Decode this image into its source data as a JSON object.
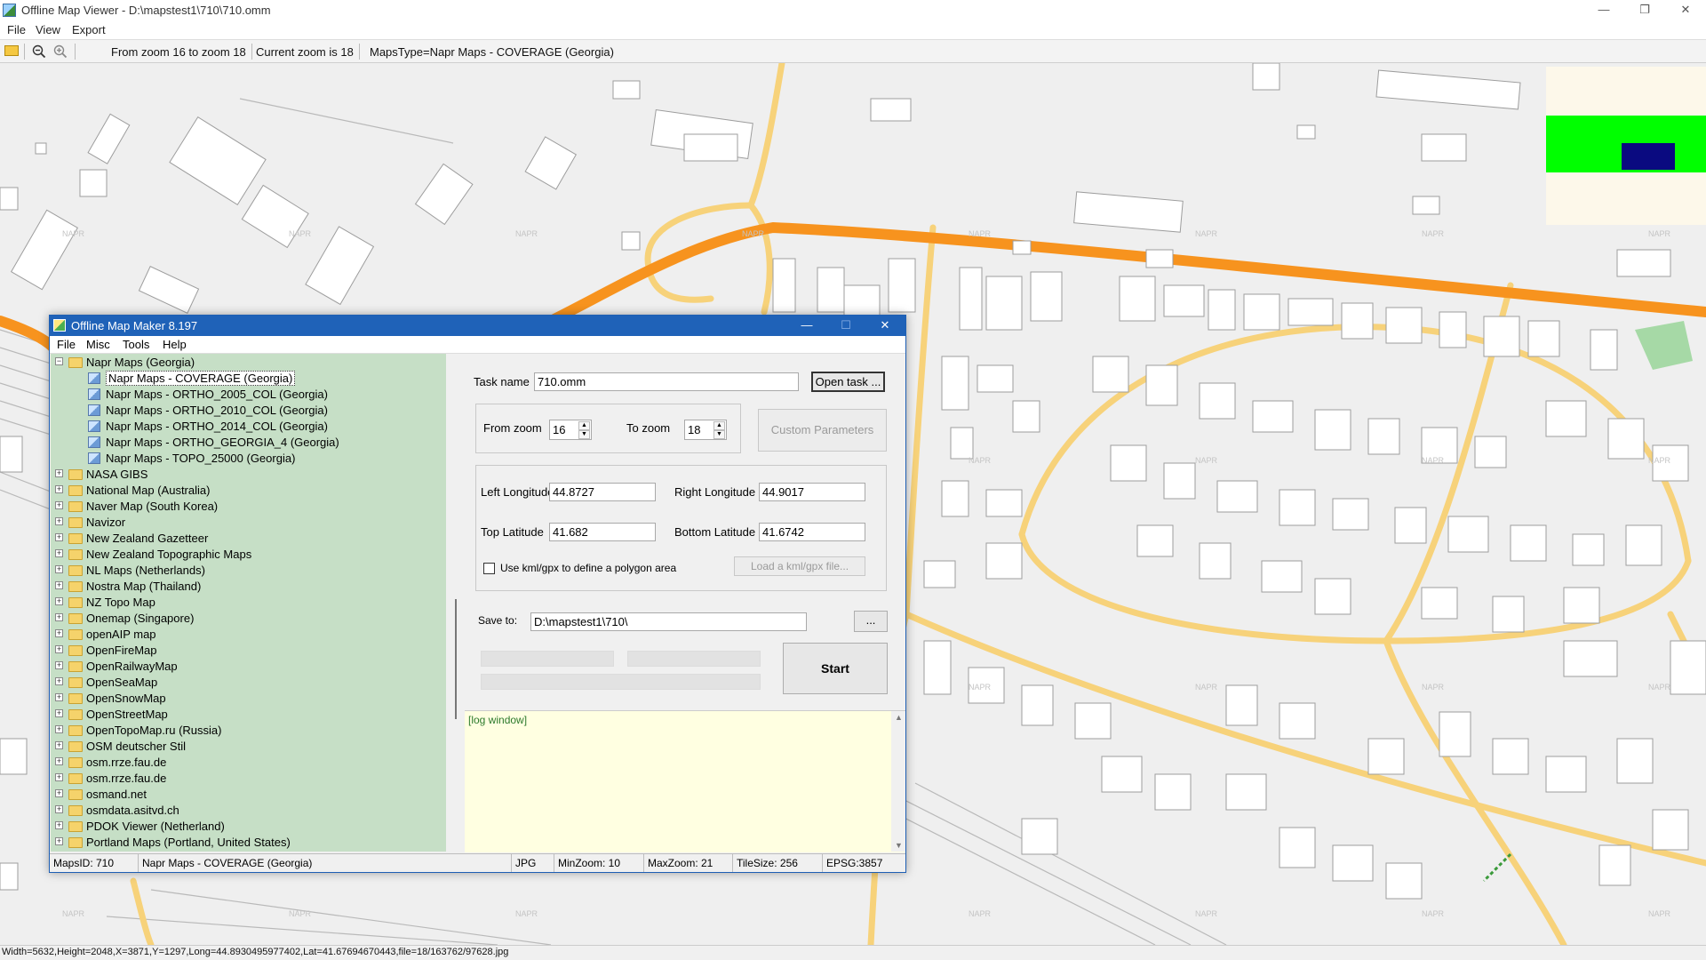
{
  "window": {
    "title": "Offline Map Viewer - D:\\mapstest1\\710\\710.omm",
    "minimize": "—",
    "maximize": "❐",
    "close": "✕"
  },
  "menu": [
    "File",
    "View",
    "Export"
  ],
  "toolbar": {
    "zoom_range": "From zoom 16 to zoom 18",
    "current_zoom": "Current zoom is 18",
    "maps_type": "MapsType=Napr Maps - COVERAGE (Georgia)"
  },
  "map": {
    "watermark": "NAPR",
    "colors": {
      "background": "#efefef",
      "major_road": "#f7931e",
      "minor_road": "#f7d27a",
      "building": "#ffffff",
      "green": "#a6d9a6"
    }
  },
  "minimap": {
    "colors": {
      "background": "#fdf8ea",
      "band": "#00ff00",
      "viewport": "#0a0a80"
    }
  },
  "statusbar": {
    "text": "Width=5632,Height=2048,X=3871,Y=1297,Long=44.8930495977402,Lat=41.67694670443,file=18/163762/97628.jpg"
  },
  "dialog": {
    "title": "Offline Map Maker 8.197",
    "minimize": "—",
    "maximize": "☐",
    "close": "✕",
    "menu": [
      "File",
      "Misc",
      "Tools",
      "Help"
    ],
    "tree": {
      "root": {
        "label": "Napr Maps (Georgia)",
        "expanded": true
      },
      "children": [
        {
          "label": "Napr Maps - COVERAGE (Georgia)",
          "selected": true
        },
        {
          "label": "Napr Maps - ORTHO_2005_COL (Georgia)"
        },
        {
          "label": "Napr Maps - ORTHO_2010_COL (Georgia)"
        },
        {
          "label": "Napr Maps - ORTHO_2014_COL (Georgia)"
        },
        {
          "label": "Napr Maps - ORTHO_GEORGIA_4 (Georgia)"
        },
        {
          "label": "Napr Maps - TOPO_25000 (Georgia)"
        }
      ],
      "folders": [
        "NASA GIBS",
        "National Map (Australia)",
        "Naver Map (South Korea)",
        "Navizor",
        "New Zealand Gazetteer",
        "New Zealand Topographic Maps",
        "NL Maps (Netherlands)",
        "Nostra Map (Thailand)",
        "NZ Topo Map",
        "Onemap (Singapore)",
        "openAIP map",
        "OpenFireMap",
        "OpenRailwayMap",
        "OpenSeaMap",
        "OpenSnowMap",
        "OpenStreetMap",
        "OpenTopoMap.ru (Russia)",
        "OSM deutscher Stil",
        "osm.rrze.fau.de",
        "osm.rrze.fau.de",
        "osmand.net",
        "osmdata.asitvd.ch",
        "PDOK Viewer (Netherland)",
        "Portland Maps (Portland, United States)"
      ]
    },
    "form": {
      "task_name_label": "Task name",
      "task_name_value": "710.omm",
      "open_task_button": "Open task ...",
      "from_zoom_label": "From zoom",
      "from_zoom_value": "16",
      "to_zoom_label": "To zoom",
      "to_zoom_value": "18",
      "custom_params_button": "Custom Parameters",
      "left_lon_label": "Left Longitude",
      "left_lon_value": "44.8727",
      "right_lon_label": "Right Longitude",
      "right_lon_value": "44.9017",
      "top_lat_label": "Top Latitude",
      "top_lat_value": "41.682",
      "bottom_lat_label": "Bottom Latitude",
      "bottom_lat_value": "41.6742",
      "kml_checkbox_label": "Use kml/gpx to define a polygon area",
      "kml_checked": false,
      "load_kml_button": "Load a kml/gpx file...",
      "save_to_label": "Save to:",
      "save_to_value": "D:\\mapstest1\\710\\",
      "browse_button": "...",
      "start_button": "Start"
    },
    "log": {
      "text": "[log window]",
      "scroll_up": "▲",
      "scroll_down": "▼"
    },
    "status": {
      "maps_id": "MapsID: 710",
      "maps_name": "Napr Maps - COVERAGE (Georgia)",
      "format": "JPG",
      "min_zoom": "MinZoom: 10",
      "max_zoom": "MaxZoom: 21",
      "tile_size": "TileSize: 256",
      "epsg": "EPSG:3857"
    }
  }
}
